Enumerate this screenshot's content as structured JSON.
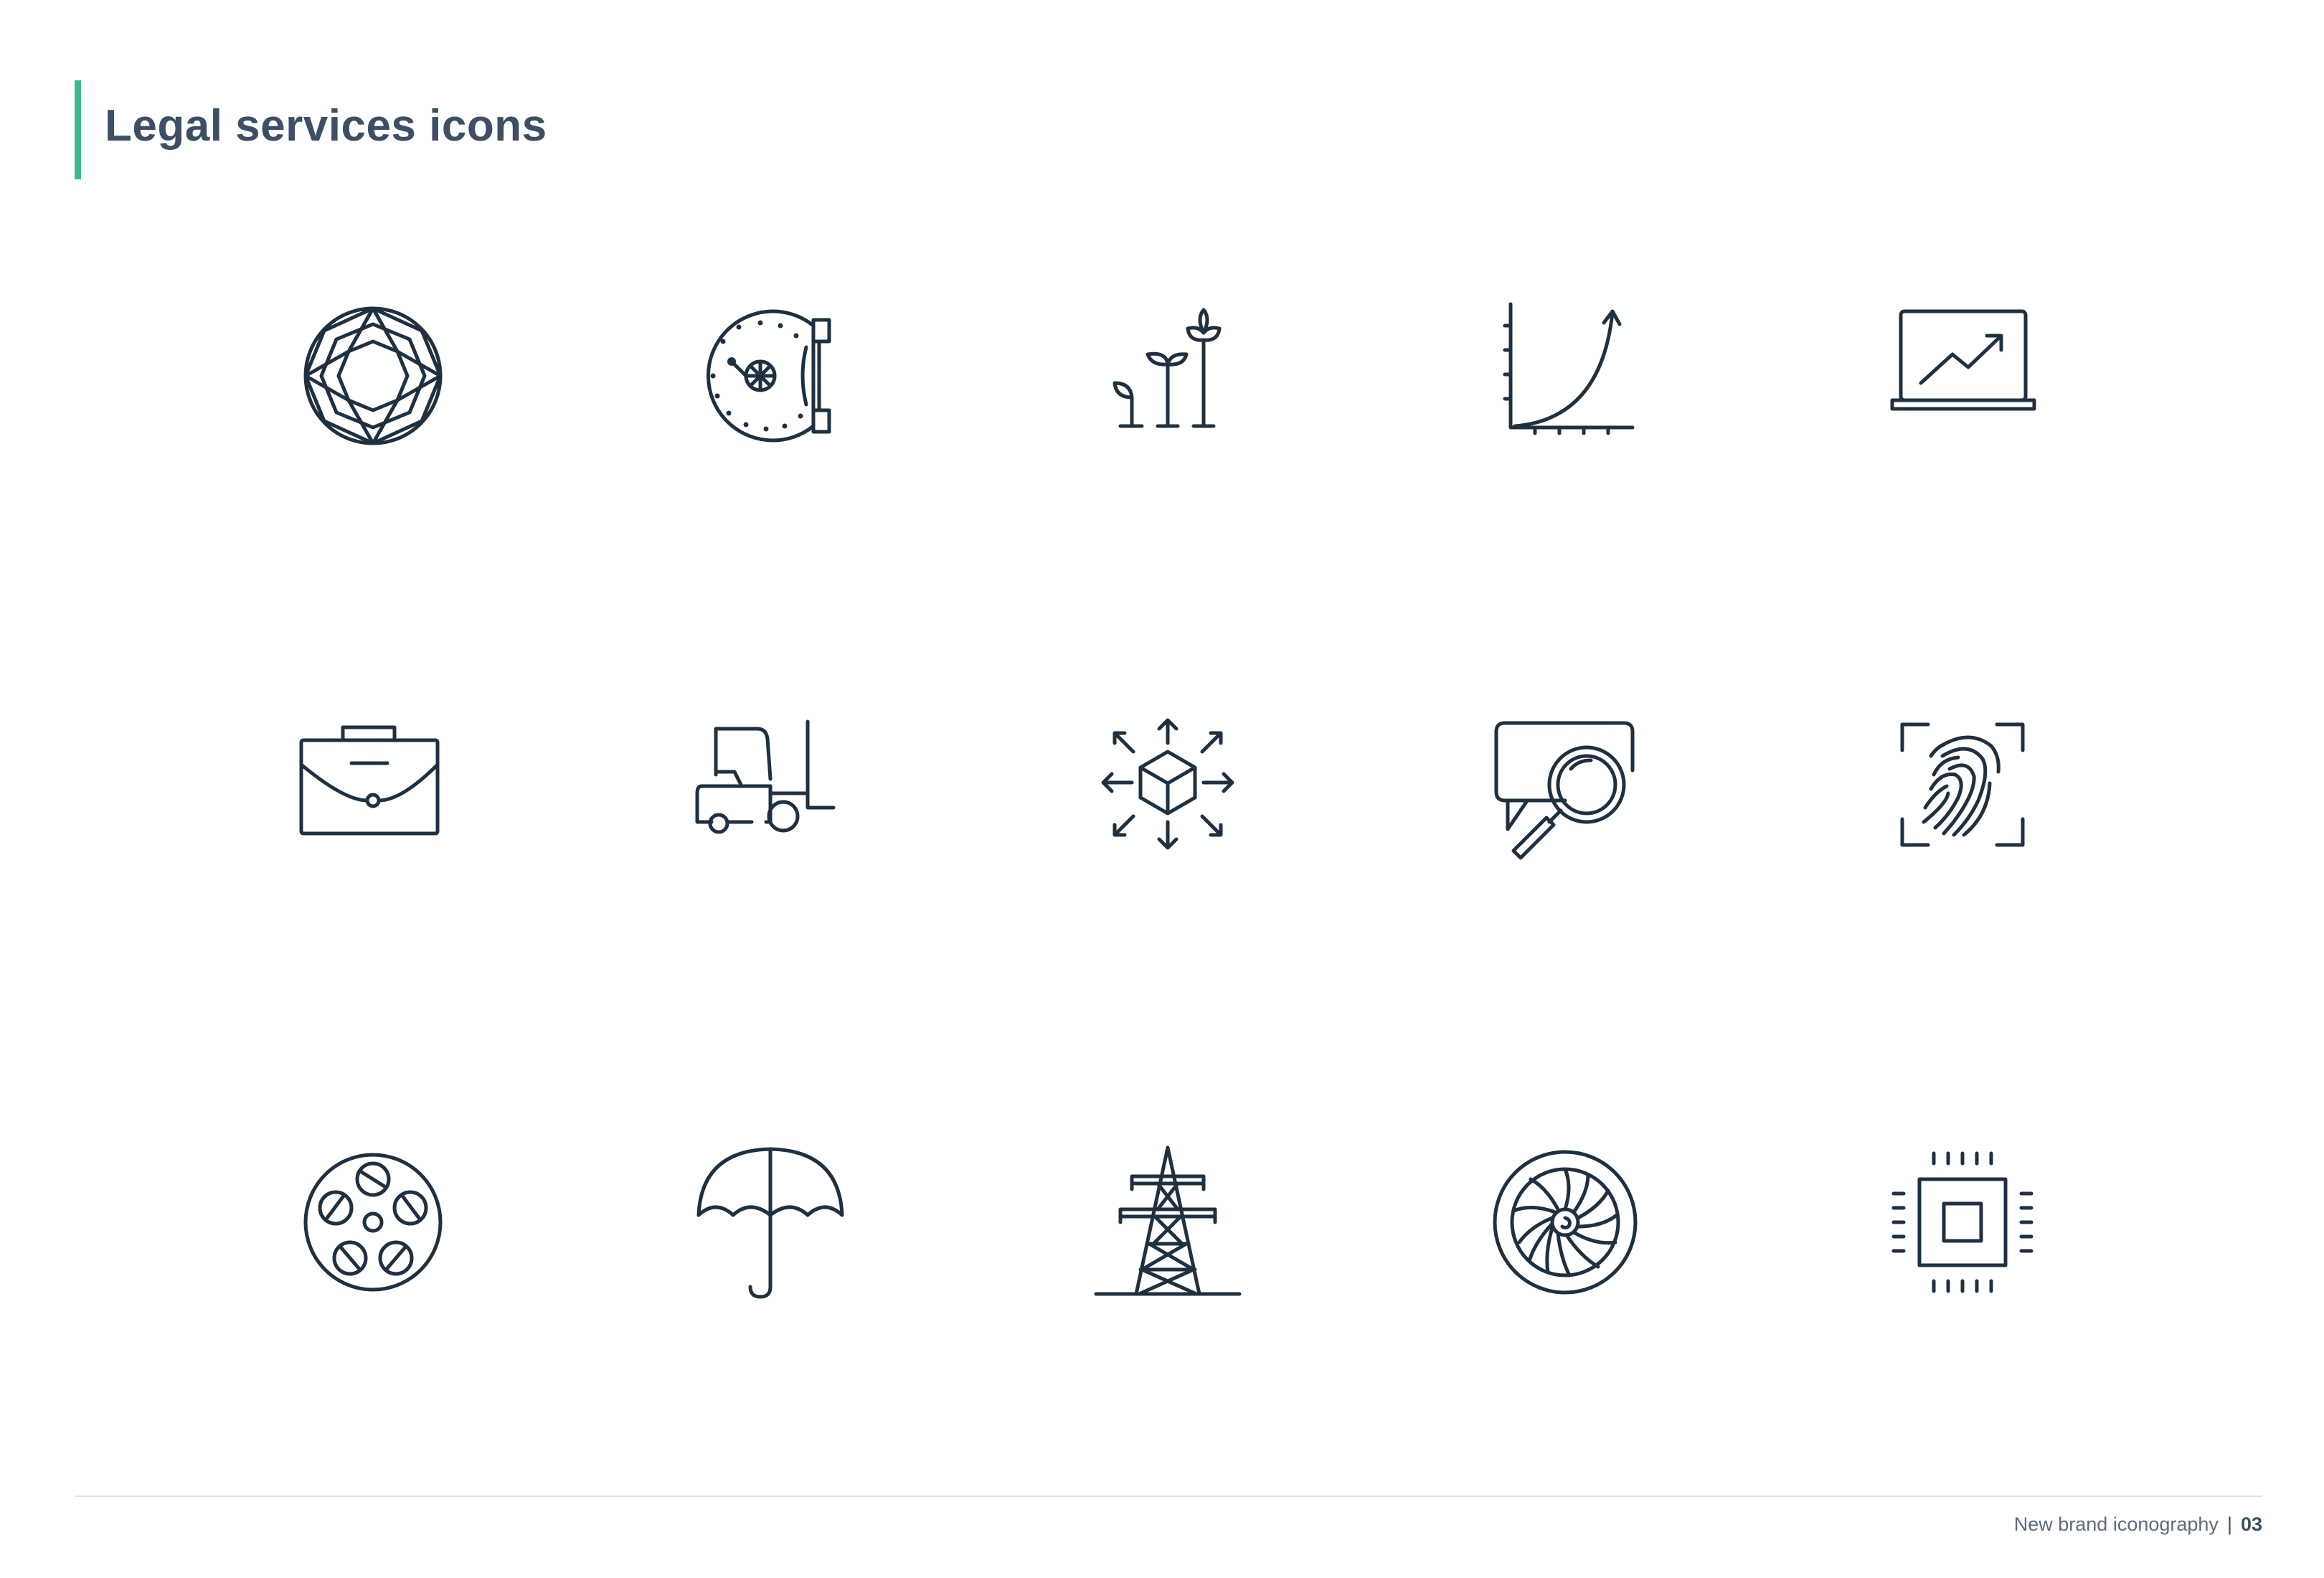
{
  "page": {
    "title": "Legal services icons",
    "accent_color": "#3fb68b",
    "icon_color": "#1f3040"
  },
  "icons": [
    {
      "name": "gemstone-icon"
    },
    {
      "name": "vault-safe-icon"
    },
    {
      "name": "growing-plants-icon"
    },
    {
      "name": "exponential-growth-chart-icon"
    },
    {
      "name": "laptop-trend-icon"
    },
    {
      "name": "briefcase-icon"
    },
    {
      "name": "forklift-icon"
    },
    {
      "name": "distribution-cube-icon"
    },
    {
      "name": "search-chat-icon"
    },
    {
      "name": "fingerprint-scan-icon"
    },
    {
      "name": "film-reel-icon"
    },
    {
      "name": "umbrella-icon"
    },
    {
      "name": "power-pylon-icon"
    },
    {
      "name": "turbine-engine-icon"
    },
    {
      "name": "microchip-icon"
    }
  ],
  "footer": {
    "label": "New brand iconography",
    "separator": "|",
    "page_number": "03"
  }
}
